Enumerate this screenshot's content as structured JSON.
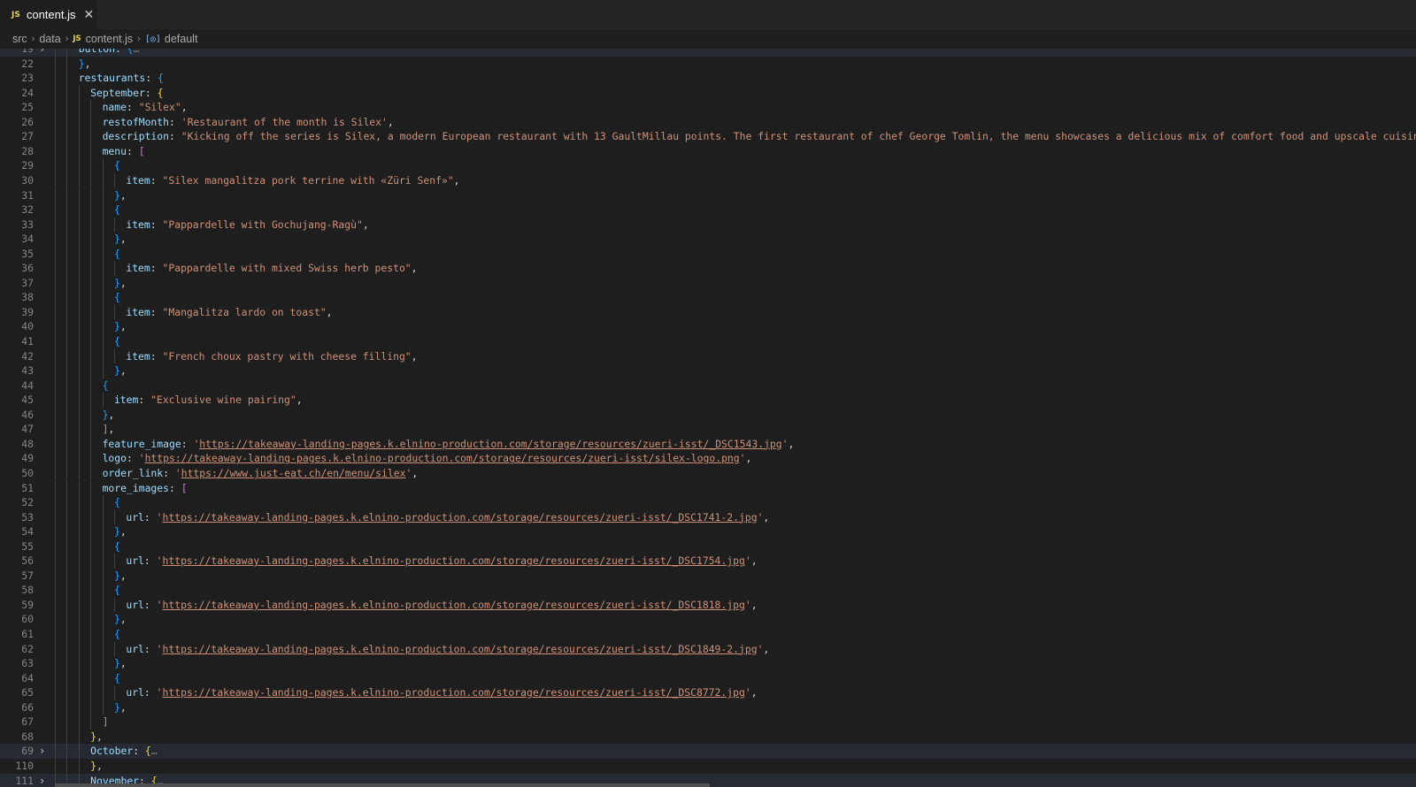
{
  "tab": {
    "badge": "JS",
    "label": "content.js",
    "close": "✕"
  },
  "breadcrumb": {
    "items": [
      "src",
      "data",
      "content.js",
      "default"
    ],
    "file_badge": "JS",
    "symbol_icon": "[◎]",
    "separator": "›"
  },
  "icons": {
    "fold_collapsed": "chevron-right-icon",
    "symbol": "variable-icon",
    "close": "close-icon"
  },
  "colors": {
    "background": "#1e1e1e",
    "key": "#9cdcfe",
    "string": "#ce9178",
    "bracket_level1": "#ffd700",
    "bracket_level2": "#da70d6",
    "bracket_level3": "#179fff",
    "line_number": "#858585"
  },
  "editor": {
    "lines": [
      {
        "n": "19",
        "indent": 2,
        "fold": true,
        "hl": true,
        "tokens": [
          [
            "k",
            "button"
          ],
          [
            "p",
            ": "
          ],
          [
            "b3",
            "{"
          ],
          [
            "collapsed",
            "…"
          ]
        ]
      },
      {
        "n": "22",
        "indent": 2,
        "tokens": [
          [
            "b3",
            "}"
          ],
          [
            "p",
            ","
          ]
        ]
      },
      {
        "n": "23",
        "indent": 2,
        "tokens": [
          [
            "k",
            "restaurants"
          ],
          [
            "p",
            ": "
          ],
          [
            "b3",
            "{"
          ]
        ]
      },
      {
        "n": "24",
        "indent": 3,
        "tokens": [
          [
            "k",
            "September"
          ],
          [
            "p",
            ": "
          ],
          [
            "b1",
            "{"
          ]
        ]
      },
      {
        "n": "25",
        "indent": 4,
        "tokens": [
          [
            "k",
            "name"
          ],
          [
            "p",
            ": "
          ],
          [
            "s",
            "\"Silex\""
          ],
          [
            "p",
            ","
          ]
        ]
      },
      {
        "n": "26",
        "indent": 4,
        "tokens": [
          [
            "k",
            "restofMonth"
          ],
          [
            "p",
            ": "
          ],
          [
            "s",
            "'Restaurant of the month is Silex'"
          ],
          [
            "p",
            ","
          ]
        ]
      },
      {
        "n": "27",
        "indent": 4,
        "tokens": [
          [
            "k",
            "description"
          ],
          [
            "p",
            ": "
          ],
          [
            "s",
            "\"Kicking off the series is Silex, a modern European restaurant with 13 GaultMillau points. The first restaurant of chef George Tomlin, the menu showcases a delicious mix of comfort food and upscale cuisine, with"
          ]
        ]
      },
      {
        "n": "28",
        "indent": 4,
        "tokens": [
          [
            "k",
            "menu"
          ],
          [
            "p",
            ": "
          ],
          [
            "b2",
            "["
          ]
        ]
      },
      {
        "n": "29",
        "indent": 5,
        "tokens": [
          [
            "b3",
            "{"
          ]
        ]
      },
      {
        "n": "30",
        "indent": 6,
        "tokens": [
          [
            "k",
            "item"
          ],
          [
            "p",
            ": "
          ],
          [
            "s",
            "\"Silex mangalitza pork terrine with «Züri Senf»\""
          ],
          [
            "p",
            ","
          ]
        ]
      },
      {
        "n": "31",
        "indent": 5,
        "tokens": [
          [
            "b3",
            "}"
          ],
          [
            "p",
            ","
          ]
        ]
      },
      {
        "n": "32",
        "indent": 5,
        "tokens": [
          [
            "b3",
            "{"
          ]
        ]
      },
      {
        "n": "33",
        "indent": 6,
        "tokens": [
          [
            "k",
            "item"
          ],
          [
            "p",
            ": "
          ],
          [
            "s",
            "\"Pappardelle with Gochujang-Ragù\""
          ],
          [
            "p",
            ","
          ]
        ]
      },
      {
        "n": "34",
        "indent": 5,
        "tokens": [
          [
            "b3",
            "}"
          ],
          [
            "p",
            ","
          ]
        ]
      },
      {
        "n": "35",
        "indent": 5,
        "tokens": [
          [
            "b3",
            "{"
          ]
        ]
      },
      {
        "n": "36",
        "indent": 6,
        "tokens": [
          [
            "k",
            "item"
          ],
          [
            "p",
            ": "
          ],
          [
            "s",
            "\"Pappardelle with mixed Swiss herb pesto\""
          ],
          [
            "p",
            ","
          ]
        ]
      },
      {
        "n": "37",
        "indent": 5,
        "tokens": [
          [
            "b3",
            "}"
          ],
          [
            "p",
            ","
          ]
        ]
      },
      {
        "n": "38",
        "indent": 5,
        "tokens": [
          [
            "b3",
            "{"
          ]
        ]
      },
      {
        "n": "39",
        "indent": 6,
        "tokens": [
          [
            "k",
            "item"
          ],
          [
            "p",
            ": "
          ],
          [
            "s",
            "\"Mangalitza lardo on toast\""
          ],
          [
            "p",
            ","
          ]
        ]
      },
      {
        "n": "40",
        "indent": 5,
        "tokens": [
          [
            "b3",
            "}"
          ],
          [
            "p",
            ","
          ]
        ]
      },
      {
        "n": "41",
        "indent": 5,
        "tokens": [
          [
            "b3",
            "{"
          ]
        ]
      },
      {
        "n": "42",
        "indent": 6,
        "tokens": [
          [
            "k",
            "item"
          ],
          [
            "p",
            ": "
          ],
          [
            "s",
            "\"French choux pastry with cheese filling\""
          ],
          [
            "p",
            ","
          ]
        ]
      },
      {
        "n": "43",
        "indent": 5,
        "tokens": [
          [
            "b3",
            "}"
          ],
          [
            "p",
            ","
          ]
        ]
      },
      {
        "n": "44",
        "indent": 4,
        "tokens": [
          [
            "b3",
            "{"
          ]
        ]
      },
      {
        "n": "45",
        "indent": 5,
        "tokens": [
          [
            "k",
            "item"
          ],
          [
            "p",
            ": "
          ],
          [
            "s",
            "\"Exclusive wine pairing\""
          ],
          [
            "p",
            ","
          ]
        ]
      },
      {
        "n": "46",
        "indent": 4,
        "tokens": [
          [
            "b3",
            "}"
          ],
          [
            "p",
            ","
          ]
        ]
      },
      {
        "n": "47",
        "indent": 4,
        "tokens": [
          [
            "b2",
            "]"
          ],
          [
            "p",
            ","
          ]
        ]
      },
      {
        "n": "48",
        "indent": 4,
        "tokens": [
          [
            "k",
            "feature_image"
          ],
          [
            "p",
            ": "
          ],
          [
            "s",
            "'"
          ],
          [
            "su",
            "https://takeaway-landing-pages.k.elnino-production.com/storage/resources/zueri-isst/_DSC1543.jpg"
          ],
          [
            "s",
            "'"
          ],
          [
            "p",
            ","
          ]
        ]
      },
      {
        "n": "49",
        "indent": 4,
        "tokens": [
          [
            "k",
            "logo"
          ],
          [
            "p",
            ": "
          ],
          [
            "s",
            "'"
          ],
          [
            "su",
            "https://takeaway-landing-pages.k.elnino-production.com/storage/resources/zueri-isst/silex-logo.png"
          ],
          [
            "s",
            "'"
          ],
          [
            "p",
            ","
          ]
        ]
      },
      {
        "n": "50",
        "indent": 4,
        "tokens": [
          [
            "k",
            "order_link"
          ],
          [
            "p",
            ": "
          ],
          [
            "s",
            "'"
          ],
          [
            "su",
            "https://www.just-eat.ch/en/menu/silex"
          ],
          [
            "s",
            "'"
          ],
          [
            "p",
            ","
          ]
        ]
      },
      {
        "n": "51",
        "indent": 4,
        "tokens": [
          [
            "k",
            "more_images"
          ],
          [
            "p",
            ": "
          ],
          [
            "b2",
            "["
          ]
        ]
      },
      {
        "n": "52",
        "indent": 5,
        "tokens": [
          [
            "b3",
            "{"
          ]
        ]
      },
      {
        "n": "53",
        "indent": 6,
        "tokens": [
          [
            "k",
            "url"
          ],
          [
            "p",
            ": "
          ],
          [
            "s",
            "'"
          ],
          [
            "su",
            "https://takeaway-landing-pages.k.elnino-production.com/storage/resources/zueri-isst/_DSC1741-2.jpg"
          ],
          [
            "s",
            "'"
          ],
          [
            "p",
            ","
          ]
        ]
      },
      {
        "n": "54",
        "indent": 5,
        "tokens": [
          [
            "b3",
            "}"
          ],
          [
            "p",
            ","
          ]
        ]
      },
      {
        "n": "55",
        "indent": 5,
        "tokens": [
          [
            "b3",
            "{"
          ]
        ]
      },
      {
        "n": "56",
        "indent": 6,
        "tokens": [
          [
            "k",
            "url"
          ],
          [
            "p",
            ": "
          ],
          [
            "s",
            "'"
          ],
          [
            "su",
            "https://takeaway-landing-pages.k.elnino-production.com/storage/resources/zueri-isst/_DSC1754.jpg"
          ],
          [
            "s",
            "'"
          ],
          [
            "p",
            ","
          ]
        ]
      },
      {
        "n": "57",
        "indent": 5,
        "tokens": [
          [
            "b3",
            "}"
          ],
          [
            "p",
            ","
          ]
        ]
      },
      {
        "n": "58",
        "indent": 5,
        "tokens": [
          [
            "b3",
            "{"
          ]
        ]
      },
      {
        "n": "59",
        "indent": 6,
        "tokens": [
          [
            "k",
            "url"
          ],
          [
            "p",
            ": "
          ],
          [
            "s",
            "'"
          ],
          [
            "su",
            "https://takeaway-landing-pages.k.elnino-production.com/storage/resources/zueri-isst/_DSC1818.jpg"
          ],
          [
            "s",
            "'"
          ],
          [
            "p",
            ","
          ]
        ]
      },
      {
        "n": "60",
        "indent": 5,
        "tokens": [
          [
            "b3",
            "}"
          ],
          [
            "p",
            ","
          ]
        ]
      },
      {
        "n": "61",
        "indent": 5,
        "tokens": [
          [
            "b3",
            "{"
          ]
        ]
      },
      {
        "n": "62",
        "indent": 6,
        "tokens": [
          [
            "k",
            "url"
          ],
          [
            "p",
            ": "
          ],
          [
            "s",
            "'"
          ],
          [
            "su",
            "https://takeaway-landing-pages.k.elnino-production.com/storage/resources/zueri-isst/_DSC1849-2.jpg"
          ],
          [
            "s",
            "'"
          ],
          [
            "p",
            ","
          ]
        ]
      },
      {
        "n": "63",
        "indent": 5,
        "tokens": [
          [
            "b3",
            "}"
          ],
          [
            "p",
            ","
          ]
        ]
      },
      {
        "n": "64",
        "indent": 5,
        "tokens": [
          [
            "b3",
            "{"
          ]
        ]
      },
      {
        "n": "65",
        "indent": 6,
        "tokens": [
          [
            "k",
            "url"
          ],
          [
            "p",
            ": "
          ],
          [
            "s",
            "'"
          ],
          [
            "su",
            "https://takeaway-landing-pages.k.elnino-production.com/storage/resources/zueri-isst/_DSC8772.jpg"
          ],
          [
            "s",
            "'"
          ],
          [
            "p",
            ","
          ]
        ]
      },
      {
        "n": "66",
        "indent": 5,
        "tokens": [
          [
            "b3",
            "}"
          ],
          [
            "p",
            ","
          ]
        ]
      },
      {
        "n": "67",
        "indent": 4,
        "tokens": [
          [
            "b2",
            "]"
          ]
        ]
      },
      {
        "n": "68",
        "indent": 3,
        "tokens": [
          [
            "b1",
            "}"
          ],
          [
            "p",
            ","
          ]
        ]
      },
      {
        "n": "69",
        "indent": 3,
        "fold": true,
        "hl": true,
        "tokens": [
          [
            "k",
            "October"
          ],
          [
            "p",
            ": "
          ],
          [
            "b1",
            "{"
          ],
          [
            "collapsed",
            "…"
          ]
        ]
      },
      {
        "n": "110",
        "indent": 3,
        "tokens": [
          [
            "b1",
            "}"
          ],
          [
            "p",
            ","
          ]
        ]
      },
      {
        "n": "111",
        "indent": 3,
        "fold": true,
        "hl": true,
        "tokens": [
          [
            "k",
            "November"
          ],
          [
            "p",
            ": "
          ],
          [
            "b1",
            "{"
          ],
          [
            "collapsed",
            "…"
          ]
        ]
      }
    ]
  }
}
